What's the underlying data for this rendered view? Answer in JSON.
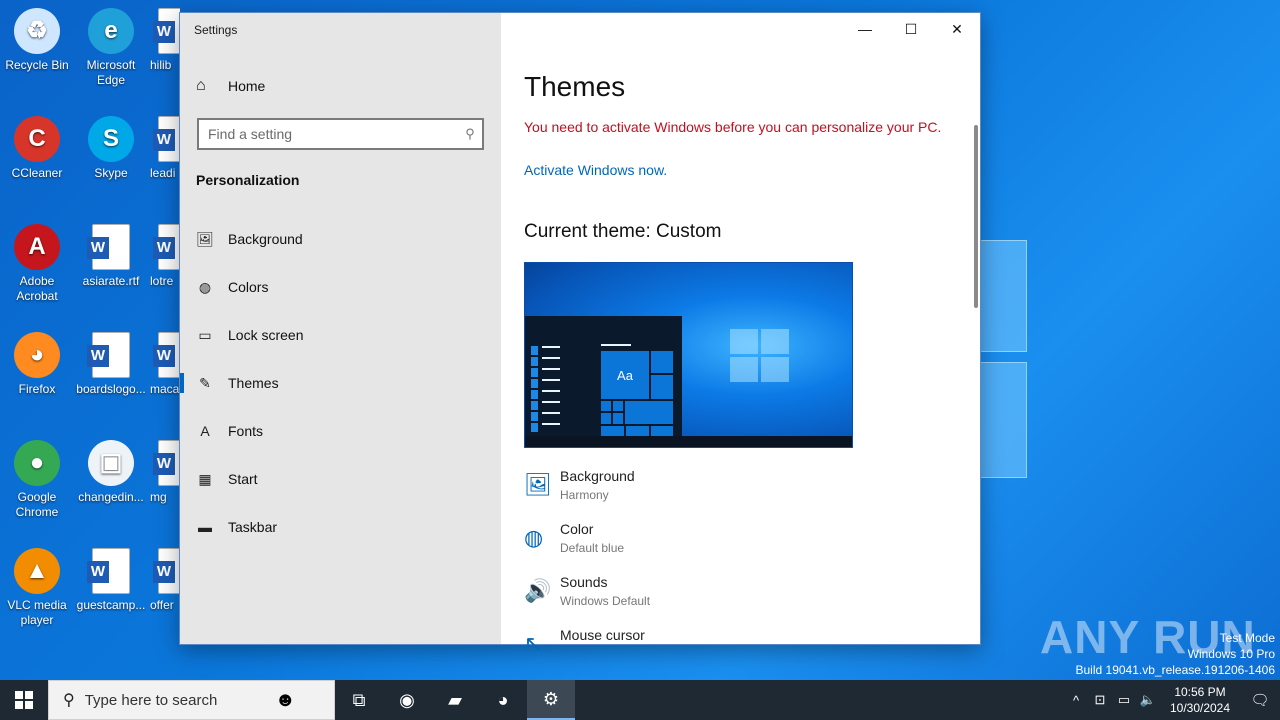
{
  "desktop": {
    "icons": [
      {
        "label": "Recycle Bin",
        "icon": "recycle-bin-icon"
      },
      {
        "label": "Microsoft Edge",
        "icon": "edge-icon"
      },
      {
        "label": "hilib",
        "icon": "word-doc-icon"
      },
      {
        "label": "CCleaner",
        "icon": "ccleaner-icon"
      },
      {
        "label": "Skype",
        "icon": "skype-icon"
      },
      {
        "label": "leadi",
        "icon": "word-doc-icon"
      },
      {
        "label": "Adobe Acrobat",
        "icon": "acrobat-icon"
      },
      {
        "label": "asiarate.rtf",
        "icon": "word-doc-icon"
      },
      {
        "label": "lotre",
        "icon": "word-doc-icon"
      },
      {
        "label": "Firefox",
        "icon": "firefox-icon"
      },
      {
        "label": "boardslogo...",
        "icon": "word-doc-icon"
      },
      {
        "label": "maca",
        "icon": "word-doc-icon"
      },
      {
        "label": "Google Chrome",
        "icon": "chrome-icon"
      },
      {
        "label": "changedin...",
        "icon": "image-file-icon"
      },
      {
        "label": "mg",
        "icon": "word-doc-icon"
      },
      {
        "label": "VLC media player",
        "icon": "vlc-icon"
      },
      {
        "label": "guestcamp...",
        "icon": "word-doc-icon"
      },
      {
        "label": "offer",
        "icon": "word-doc-icon"
      }
    ],
    "watermark": {
      "line1": "Test Mode",
      "line2": "Windows 10 Pro",
      "line3": "Build 19041.vb_release.191206-1406"
    },
    "brand": "ANY RUN"
  },
  "window": {
    "title": "Settings",
    "controls": {
      "minimize": "—",
      "maximize": "☐",
      "close": "✕"
    },
    "sidebar": {
      "home": "Home",
      "search_placeholder": "Find a setting",
      "section": "Personalization",
      "items": [
        {
          "label": "Background",
          "icon": "picture-icon",
          "glyph": "🖼"
        },
        {
          "label": "Colors",
          "icon": "palette-icon",
          "glyph": "◍"
        },
        {
          "label": "Lock screen",
          "icon": "lock-screen-icon",
          "glyph": "▭"
        },
        {
          "label": "Themes",
          "icon": "brush-icon",
          "glyph": "✎",
          "active": true
        },
        {
          "label": "Fonts",
          "icon": "font-icon",
          "glyph": "A"
        },
        {
          "label": "Start",
          "icon": "start-tiles-icon",
          "glyph": "▦"
        },
        {
          "label": "Taskbar",
          "icon": "taskbar-icon",
          "glyph": "▬"
        }
      ]
    },
    "content": {
      "title": "Themes",
      "warning": "You need to activate Windows before you can personalize your PC.",
      "activate_link": "Activate Windows now.",
      "current_theme": "Current theme: Custom",
      "preview_tile": "Aa",
      "properties": [
        {
          "title": "Background",
          "value": "Harmony",
          "icon": "picture-icon",
          "glyph": "🖼"
        },
        {
          "title": "Color",
          "value": "Default blue",
          "icon": "palette-icon",
          "glyph": "◍"
        },
        {
          "title": "Sounds",
          "value": "Windows Default",
          "icon": "speaker-icon",
          "glyph": "🔊"
        },
        {
          "title": "Mouse cursor",
          "value": "",
          "icon": "cursor-icon",
          "glyph": "↖"
        }
      ]
    }
  },
  "taskbar": {
    "search_placeholder": "Type here to search",
    "apps": [
      {
        "name": "task-view",
        "glyph": "⧉"
      },
      {
        "name": "edge",
        "glyph": "◉"
      },
      {
        "name": "file-explorer",
        "glyph": "▰"
      },
      {
        "name": "firefox",
        "glyph": "◕"
      },
      {
        "name": "settings",
        "glyph": "⚙",
        "active": true
      }
    ],
    "clock": {
      "time": "10:56 PM",
      "date": "10/30/2024"
    },
    "accent": "#0067c0"
  }
}
